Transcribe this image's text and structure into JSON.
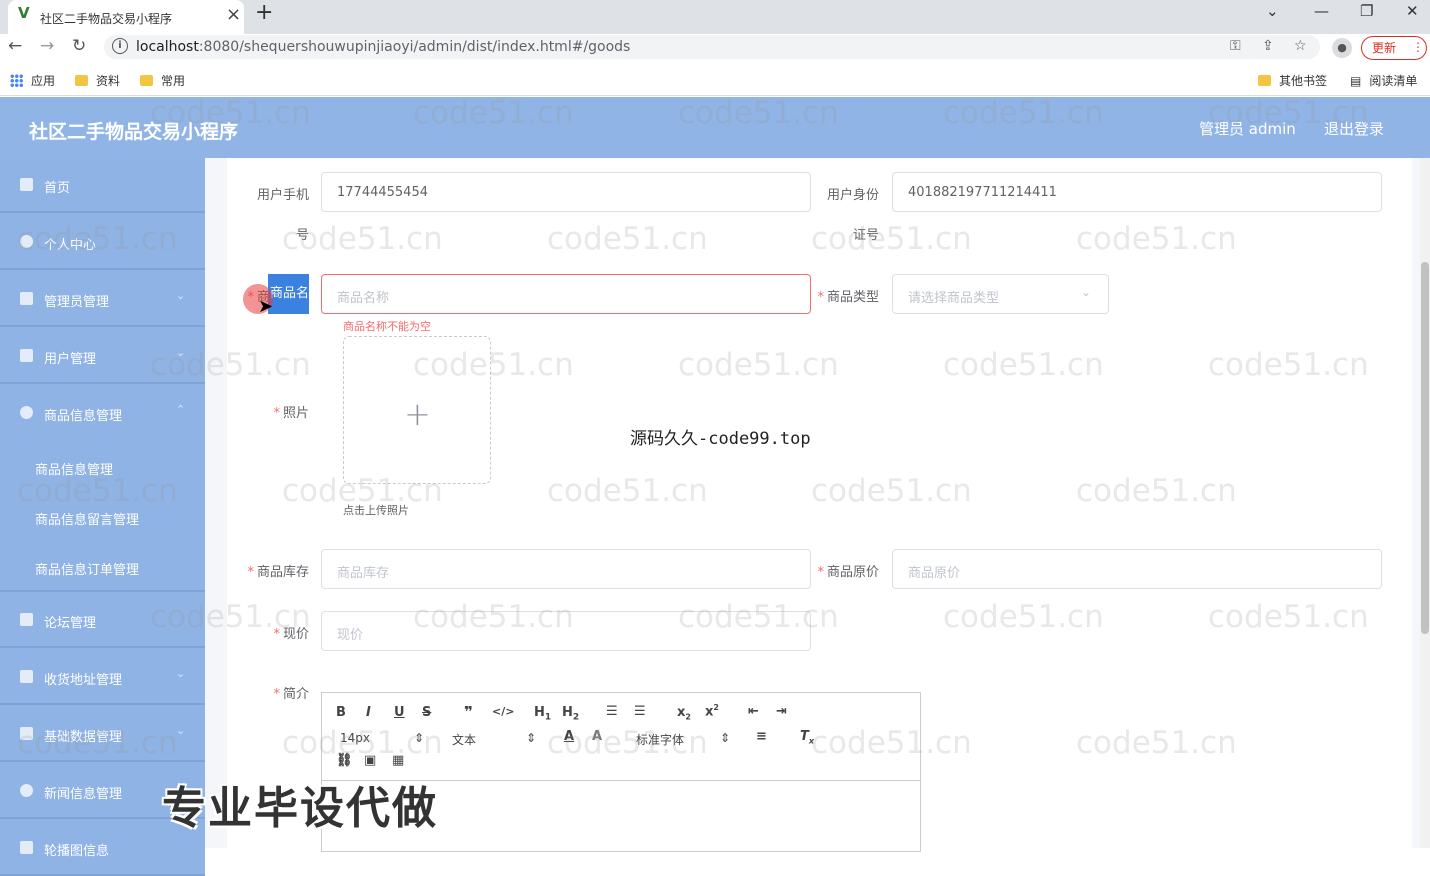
{
  "browser": {
    "tab_title": "社区二手物品交易小程序",
    "url_host": "localhost",
    "url_rest": ":8080/shequershouwupinjiaoyi/admin/dist/index.html#/goods",
    "update_label": "更新",
    "bookmarks": [
      "应用",
      "资料",
      "常用"
    ],
    "other_bookmarks": "其他书签",
    "reading_list": "阅读清单"
  },
  "header": {
    "title": "社区二手物品交易小程序",
    "admin": "管理员 admin",
    "logout": "退出登录"
  },
  "sidebar": {
    "items": [
      {
        "label": "首页",
        "icon": "home-icon"
      },
      {
        "label": "个人中心",
        "icon": "user-icon"
      },
      {
        "label": "管理员管理",
        "icon": "grid-icon"
      },
      {
        "label": "用户管理",
        "icon": "users-icon"
      },
      {
        "label": "商品信息管理",
        "icon": "user-icon"
      },
      {
        "label": "论坛管理",
        "icon": "list-icon"
      },
      {
        "label": "收货地址管理",
        "icon": "grid-icon"
      },
      {
        "label": "基础数据管理",
        "icon": "flag-icon"
      },
      {
        "label": "新闻信息管理",
        "icon": "power-icon"
      },
      {
        "label": "轮播图信息",
        "icon": "image-icon"
      }
    ],
    "sub_items": [
      "商品信息管理",
      "商品信息留言管理",
      "商品信息订单管理"
    ]
  },
  "form": {
    "phone_label_1": "用户手机",
    "phone_label_2": "号",
    "phone_value": "17744455454",
    "idcard_label_1": "用户身份",
    "idcard_label_2": "证号",
    "idcard_value": "401882197711214411",
    "name_label": "商品名称",
    "name_placeholder": "商品名称",
    "name_error": "商品名称不能为空",
    "type_label": "商品类型",
    "type_placeholder": "请选择商品类型",
    "photo_label": "照片",
    "photo_tip": "点击上传照片",
    "stock_label": "商品库存",
    "stock_placeholder": "商品库存",
    "price_label": "商品原价",
    "price_placeholder": "商品原价",
    "current_label": "现价",
    "current_placeholder": "现价",
    "intro_label": "简介",
    "required_mark": "*"
  },
  "editor": {
    "size": "14px",
    "header": "文本",
    "font": "标准字体"
  },
  "overlays": {
    "watermark": "code51.cn",
    "center_watermark": "源码久久-code99.top",
    "bottom_watermark": "专业毕设代做"
  }
}
